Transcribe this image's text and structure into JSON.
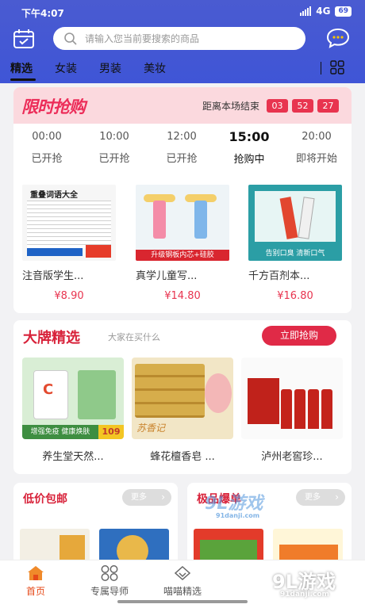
{
  "status_bar": {
    "time": "下午4:07",
    "network": "4G",
    "battery": "69"
  },
  "search": {
    "placeholder": "请输入您当前要搜索的商品"
  },
  "tabs": [
    {
      "label": "精选",
      "active": true
    },
    {
      "label": "女装",
      "active": false
    },
    {
      "label": "男装",
      "active": false
    },
    {
      "label": "美妆",
      "active": false
    }
  ],
  "flash_sale": {
    "logo": "限时抢购",
    "countdown_label": "距离本场结束",
    "countdown": [
      "03",
      "52",
      "27"
    ],
    "slots": [
      {
        "time": "00:00",
        "status": "已开抢"
      },
      {
        "time": "10:00",
        "status": "已开抢"
      },
      {
        "time": "12:00",
        "status": "已开抢"
      },
      {
        "time": "15:00",
        "status": "抢购中",
        "active": true
      },
      {
        "time": "20:00",
        "status": "即将开始"
      }
    ],
    "items": [
      {
        "name": "注音版学生...",
        "price": "¥8.90",
        "image_text": "重叠词语大全"
      },
      {
        "name": "真学儿童写...",
        "price": "¥14.80",
        "image_text": "升级钢板内芯+硅胶"
      },
      {
        "name": "千方百剂本...",
        "price": "¥16.80",
        "image_text": "告别口臭 清新口气"
      }
    ]
  },
  "brand_picks": {
    "title": "大牌精选",
    "subtitle": "大家在买什么",
    "cta": "立即抢购",
    "items": [
      {
        "name": "养生堂天然...",
        "image_text": "增强免疫 健康焕肤",
        "badge": "109"
      },
      {
        "name": "蜂花檀香皂 ...",
        "image_text": "苏香记"
      },
      {
        "name": "泸州老窖珍..."
      }
    ]
  },
  "mini_cards": [
    {
      "title": "低价包邮",
      "more": "更多"
    },
    {
      "title": "极品爆单",
      "more": "更多"
    }
  ],
  "bottom_nav": [
    {
      "label": "首页",
      "active": true,
      "icon": "home-icon"
    },
    {
      "label": "专属导师",
      "active": false,
      "icon": "grid-circles-icon"
    },
    {
      "label": "喵喵精选",
      "active": false,
      "icon": "diamond-icon"
    }
  ],
  "watermarks": {
    "primary": "9L游戏",
    "primary_sub": "91danji.com",
    "secondary": "9L游戏",
    "secondary_sub": "91danji.com"
  },
  "colors": {
    "header": "#3f55d6",
    "accent": "#e02a47",
    "flash_head": "#fbd9de"
  }
}
